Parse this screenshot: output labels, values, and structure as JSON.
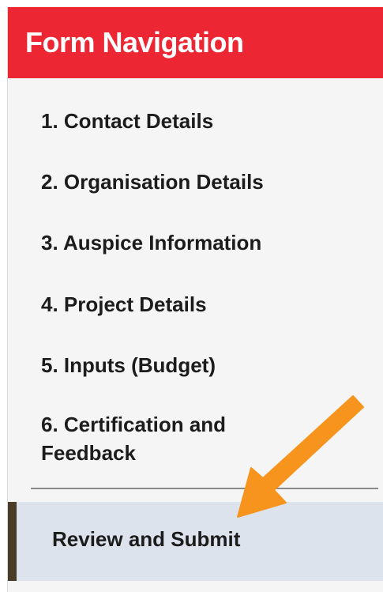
{
  "header": {
    "title": "Form Navigation"
  },
  "nav": {
    "items": [
      {
        "label": "1. Contact Details"
      },
      {
        "label": "2. Organisation Details"
      },
      {
        "label": "3. Auspice Information"
      },
      {
        "label": "4. Project Details"
      },
      {
        "label": "5. Inputs (Budget)"
      },
      {
        "label": "6. Certification and Feedback"
      }
    ],
    "review_label": "Review and Submit"
  },
  "colors": {
    "header_bg": "#ec2733",
    "review_bg": "#dde3ec",
    "review_marker": "#4a3c26",
    "arrow": "#f7941d"
  },
  "icons": {
    "annotation": "arrow-down-left-icon"
  }
}
